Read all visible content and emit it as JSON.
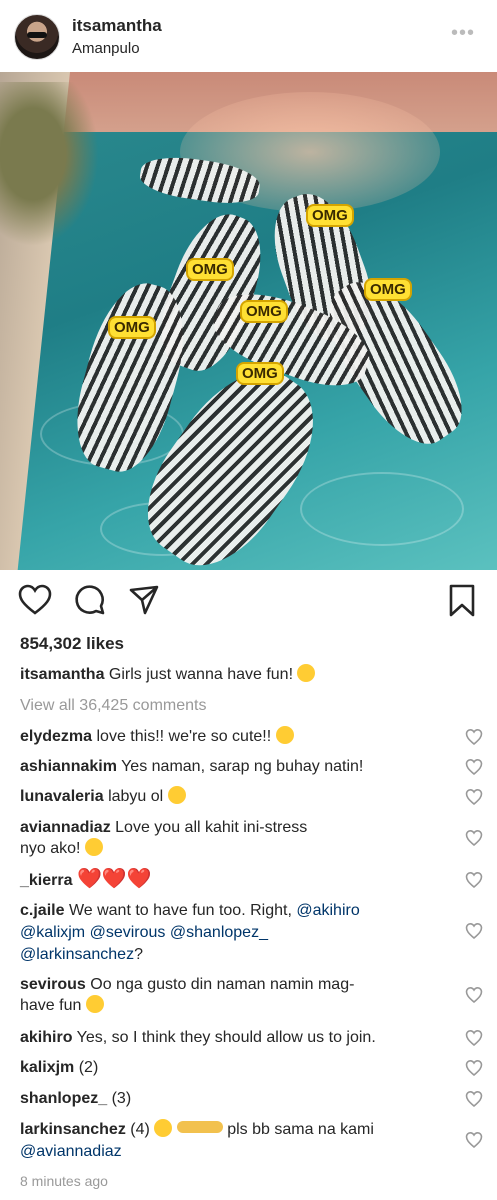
{
  "post": {
    "username": "itsamantha",
    "location": "Amanpulo",
    "more_label": "•••",
    "photo_overlays": [
      "OMG",
      "OMG",
      "OMG",
      "OMG",
      "OMG",
      "OMG"
    ],
    "likes": "854,302 likes",
    "caption": {
      "user": "itsamantha",
      "text": "Girls just wanna have fun!"
    },
    "view_all": "View all 36,425 comments",
    "timestamp": "8 minutes ago"
  },
  "comments": [
    {
      "user": "elydezma",
      "text": "love this!! we're so cute!!"
    },
    {
      "user": "ashiannakim",
      "text": "Yes naman, sarap ng buhay natin!"
    },
    {
      "user": "lunavaleria",
      "text": "labyu ol"
    },
    {
      "user": "aviannadiaz",
      "text": "Love you all kahit ini-stress",
      "text2": "nyo ako!"
    },
    {
      "user": "_kierra",
      "text": "❤️❤️❤️"
    },
    {
      "user": "c.jaile",
      "text": "We want to have fun too. Right,",
      "m1": "@akihiro",
      "m2": "@kalixjm",
      "m3": "@sevirous",
      "m4": "@shanlopez_",
      "m5": "@larkinsanchez",
      "tail": "?"
    },
    {
      "user": "sevirous",
      "text": "Oo nga gusto din naman namin mag-",
      "text2": "have fun"
    },
    {
      "user": "akihiro",
      "text": "Yes, so I think they should allow us to join."
    },
    {
      "user": "kalixjm",
      "text": "(2)"
    },
    {
      "user": "shanlopez_",
      "text": "(3)"
    },
    {
      "user": "larkinsanchez",
      "text": "(4)",
      "text_b": "pls bb sama na kami",
      "m1": "@aviannadiaz"
    }
  ],
  "colors": {
    "text": "#262626",
    "muted": "#999999",
    "mention": "#003569",
    "heart": "#e0245e"
  },
  "icons": [
    "heart-icon",
    "comment-icon",
    "share-icon",
    "bookmark-icon"
  ]
}
